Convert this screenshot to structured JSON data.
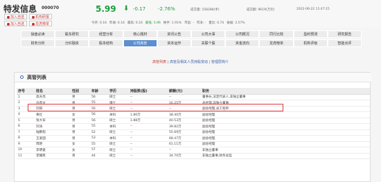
{
  "stock": {
    "name": "特发信息",
    "code": "000070",
    "price": "5.99",
    "change": "-0.17",
    "change_pct": "-2.76%",
    "volume": "成交量: 158288(手)",
    "amount": "成交额: 9619(万元)",
    "time": "2022-06-22 11:47:15"
  },
  "buttons": {
    "add_watch": "加入自选",
    "orgs": "机构研报",
    "buy": "龙虎榜单",
    "add": "加入自选",
    "research": "机构研报"
  },
  "stats": [
    {
      "label": "今开",
      "value": "6.16"
    },
    {
      "label": "昨收",
      "value": "6.16"
    },
    {
      "label": "最高",
      "value": "6.16"
    },
    {
      "label": "最低",
      "value": "5.96"
    },
    {
      "label": "换手",
      "value": "1.91%"
    },
    {
      "label": "市盈",
      "value": "-"
    },
    {
      "label": "市净",
      "value": "-"
    },
    {
      "label": "量比",
      "value": "0.74"
    },
    {
      "label": "振幅",
      "value": "3.57%"
    }
  ],
  "nav": {
    "row1": [
      "操盘必读",
      "股东研究",
      "经营分析",
      "核心题材",
      "资讯公告",
      "公司大事",
      "公司概况",
      "同行比较",
      "盈利预测",
      "研究报告"
    ],
    "row2": [
      "财务分析",
      "分红融资",
      "股本结构",
      "公司高管",
      "资本运作",
      "关联个股",
      "资金流向",
      "龙虎榜单",
      "机构评级",
      "智能点评"
    ],
    "active": "公司高管"
  },
  "sublinks": {
    "a": "高管列表",
    "sep1": "|",
    "b": "高管及相关人员持股变动",
    "sep2": "|",
    "c": "管理层简介"
  },
  "panel": {
    "title": "高管列表"
  },
  "table": {
    "headers": [
      "序号",
      "姓名",
      "性别",
      "年龄",
      "学历",
      "持股数(股)",
      "薪酬(元)",
      "职务"
    ],
    "rows": [
      [
        "1",
        "高天亮",
        "男",
        "56",
        "硕士",
        "--",
        "--",
        "董事长,法定代表人,非独立董事"
      ],
      [
        "2",
        "岳丙文",
        "男",
        "55",
        "博士",
        "--",
        "16.25万",
        "总经理,非独立董事"
      ],
      [
        "3",
        "刘阳",
        "男",
        "56",
        "硕士",
        "--",
        "--",
        "副总经理,总工程师"
      ],
      [
        "4",
        "黄红",
        "女",
        "56",
        "本科",
        "1.80万",
        "38.40万",
        "副总经理"
      ],
      [
        "5",
        "张大军",
        "男",
        "56",
        "硕士",
        "1.88万",
        "40.53万",
        "副总经理"
      ],
      [
        "6",
        "刘涛",
        "男",
        "55",
        "本科",
        "--",
        "39.82万",
        "副总经理"
      ],
      [
        "7",
        "陆鹏程",
        "男",
        "52",
        "硕士",
        "--",
        "55.69万",
        "副总经理"
      ],
      [
        "8",
        "王爱国",
        "男",
        "53",
        "本科",
        "--",
        "68.47万",
        "副总经理"
      ],
      [
        "9",
        "周艳",
        "女",
        "55",
        "硕士",
        "--",
        "61.11万",
        "副总经理"
      ],
      [
        "10",
        "李明俊",
        "女",
        "57",
        "硕士",
        "--",
        "--",
        "非独立董事"
      ],
      [
        "11",
        "李耀民",
        "男",
        "44",
        "硕士",
        "--",
        "34.70万",
        "非独立董事,财务总监"
      ]
    ]
  }
}
